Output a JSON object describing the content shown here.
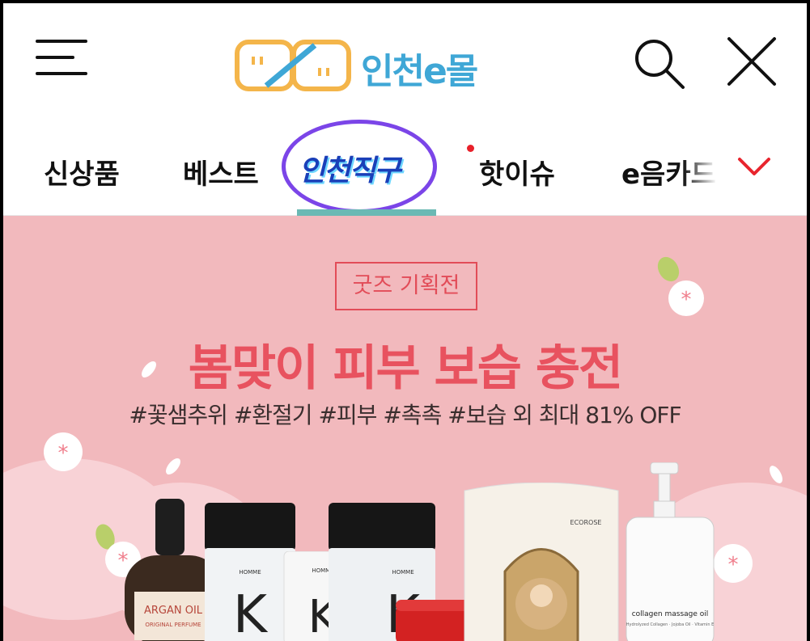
{
  "header": {
    "logo_text": "인천e몰",
    "logo_face": "'' /..",
    "menu_icon": "hamburger-icon",
    "search_icon": "search-icon",
    "close_icon": "close-icon"
  },
  "nav": {
    "tabs": [
      {
        "label": "신상품"
      },
      {
        "label": "베스트"
      },
      {
        "label": "인천직구",
        "active": true
      },
      {
        "label": "핫이슈",
        "has_new_dot": true
      },
      {
        "label": "e음카드"
      }
    ],
    "more_icon": "chevron-down-icon",
    "active_underline_color": "#6bb9b4",
    "highlight_ring_color": "#7b45e8",
    "new_dot_color": "#e8202a"
  },
  "banner": {
    "badge": "굿즈 기획전",
    "headline": "봄맞이 피부 보습 충전",
    "subtitle": "#꽃샘추위 #환절기 #피부 #촉촉 #보습 외 최대 81% OFF",
    "background_color": "#f2b9bd",
    "accent_color": "#e8525f",
    "products": [
      {
        "label": "ARGAN OIL",
        "sublabel": "ORIGINAL PERFUME"
      },
      {
        "label": "K",
        "brand": "HOMME"
      },
      {
        "label": "K",
        "brand": "HOMME"
      },
      {
        "label": "K",
        "brand": "HOMME"
      },
      {
        "label": "ECOROSE"
      },
      {
        "label": "collagen massage oil",
        "sublabel": "Hydrolyzed Collagen · Jojoba Oil · Vitamin E"
      }
    ]
  }
}
